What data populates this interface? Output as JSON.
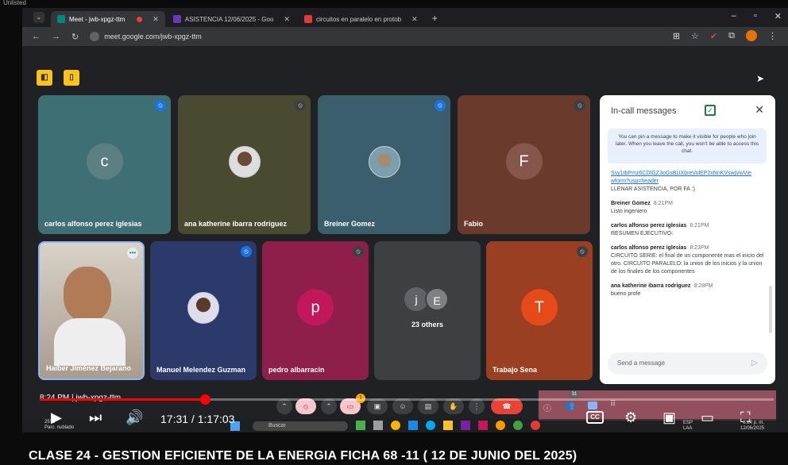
{
  "top_label": "Unlisted",
  "tabs": [
    {
      "label": "Meet - jwb-xpgz-ttm",
      "icon": "meet-icon",
      "active": true
    },
    {
      "label": "ASISTENCIA 12/06/2025 - Goo",
      "icon": "forms-icon",
      "active": false
    },
    {
      "label": "circuitos en paralelo en protob",
      "icon": "youtube-icon",
      "active": false
    }
  ],
  "address": "meet.google.com/jwb-xpgz-ttm",
  "tiles": [
    {
      "name": "carlos alfonso perez iglesias",
      "letter": "c",
      "bg": "#3e6f74",
      "circle": "#5b7f83"
    },
    {
      "name": "ana katherine ibarra rodriguez",
      "bg": "#4a4a31"
    },
    {
      "name": "Breiner Gomez",
      "bg": "#3a5e6b"
    },
    {
      "name": "Fabio",
      "letter": "F",
      "bg": "#6a3a2c",
      "circle": "#87564a"
    },
    {
      "name": "Haiber Jiménez Bejarano",
      "bg": "#bdb5aa"
    },
    {
      "name": "Manuel Melendez Guzman",
      "bg": "#2b3a6b"
    },
    {
      "name": "pedro albarracin",
      "letter": "p",
      "bg": "#8d1f4a",
      "circle": "#c2185b"
    },
    {
      "name": "23 others",
      "letters": [
        "j",
        "E"
      ],
      "bg": "#3c4043"
    },
    {
      "name": "Trabajo Sena",
      "letter": "T",
      "bg": "#9a3f22",
      "circle": "#e64a19"
    }
  ],
  "chat": {
    "title": "In-call messages",
    "pin_note": "You can pin a message to make it visible for people who join later. When you leave the call, you won't be able to access this chat.",
    "link": "Ssy1tbPmz6CDIGZ3oGsBUXbreVolEP2xNnKVswjVwVie wform?usp=header",
    "link_note": "LLENAR ASISTENCIA, POR FA :)",
    "messages": [
      {
        "who": "Breiner Gomez",
        "time": "8:21PM",
        "text": "Listo ingeniero"
      },
      {
        "who": "carlos alfonso perez iglesias",
        "time": "8:21PM",
        "text": "RESUMEN EJECUTIVO:"
      },
      {
        "who": "carlos alfonso perez iglesias",
        "time": "8:23PM",
        "text": "CIRCUITO SERIE: el final de un componente mas el inicio del otro. CIRCUITO PARALELO: la union de los inicios y la union de los finales de los componentes"
      },
      {
        "who": "ana katherine ibarra rodriguez",
        "time": "8:28PM",
        "text": "bueno profe"
      }
    ],
    "send_placeholder": "Send a message"
  },
  "meeting_info": "8:24 PM | jwb-xpgz-ttm",
  "people_count": "31",
  "badge_count": "1",
  "video": {
    "time": "17:31 / 1:17:03",
    "progress": 0.2246
  },
  "taskbar": {
    "search": "Buscar",
    "weather": "Parc. nublado",
    "lang": "ESP\nLAA",
    "date": "12/06/2025",
    "clock": "8:24 p. m."
  },
  "caption": "CLASE 24 - GESTION EFICIENTE DE LA ENERGIA FICHA 68 -11 ( 12 DE JUNIO DEL 2025)"
}
